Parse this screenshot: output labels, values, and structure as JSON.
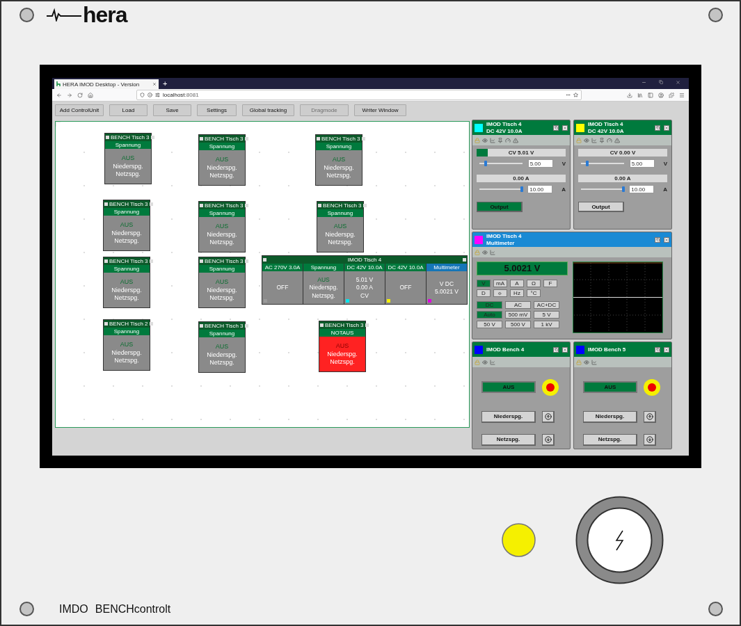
{
  "device": {
    "logo": "hera",
    "model": "IMDO",
    "product": "BENCHcontrolt"
  },
  "browser": {
    "tab_title": "HERA IMOD Desktop - Version",
    "new_tab": "+",
    "url_host": "localhost",
    "url_port": ":8081"
  },
  "toolbar": [
    {
      "label": "Add ControlUnit",
      "disabled": false
    },
    {
      "label": "Load",
      "disabled": false
    },
    {
      "label": "Save",
      "disabled": false
    },
    {
      "label": "Settings",
      "disabled": false
    },
    {
      "label": "Global tracking",
      "disabled": false
    },
    {
      "label": "Dragmode",
      "disabled": true
    },
    {
      "label": "Writer Window",
      "disabled": false
    }
  ],
  "canvas": {
    "cards": [
      {
        "title": "BENCH Tisch 3",
        "mode": "Spannung",
        "state": "AUS",
        "lines": [
          "Niederspg.",
          "Netzspg."
        ],
        "alarm": false
      },
      {
        "title": "BENCH Tisch 3",
        "mode": "Spannung",
        "state": "AUS",
        "lines": [
          "Niederspg.",
          "Netzspg."
        ],
        "alarm": false
      },
      {
        "title": "BENCH Tisch 3",
        "mode": "Spannung",
        "state": "AUS",
        "lines": [
          "Niederspg.",
          "Netzspg."
        ],
        "alarm": false
      },
      {
        "title": "BENCH Tisch 3",
        "mode": "Spannung",
        "state": "AUS",
        "lines": [
          "Niederspg.",
          "Netzspg."
        ],
        "alarm": false
      },
      {
        "title": "BENCH Tisch 3",
        "mode": "Spannung",
        "state": "AUS",
        "lines": [
          "Niederspg.",
          "Netzspg."
        ],
        "alarm": false
      },
      {
        "title": "BENCH Tisch 3",
        "mode": "Spannung",
        "state": "AUS",
        "lines": [
          "Niederspg.",
          "Netzspg."
        ],
        "alarm": false
      },
      {
        "title": "BENCH Tisch 3",
        "mode": "Spannung",
        "state": "AUS",
        "lines": [
          "Niederspg.",
          "Netzspg."
        ],
        "alarm": false
      },
      {
        "title": "BENCH Tisch 3",
        "mode": "Spannung",
        "state": "AUS",
        "lines": [
          "Niederspg.",
          "Netzspg."
        ],
        "alarm": false
      },
      {
        "title": "BENCH Tisch 2",
        "mode": "Spannung",
        "state": "AUS",
        "lines": [
          "Niederspg.",
          "Netzspg."
        ],
        "alarm": false
      },
      {
        "title": "BENCH Tisch 3",
        "mode": "Spannung",
        "state": "AUS",
        "lines": [
          "Niederspg.",
          "Netzspg."
        ],
        "alarm": false
      },
      {
        "title": "BENCH Tisch 3",
        "mode": "NOTAUS",
        "state": "AUS",
        "lines": [
          "Niederspg.",
          "Netzspg."
        ],
        "alarm": true
      }
    ],
    "module": {
      "title": "IMOD Tisch 4",
      "channels": [
        {
          "header": "AC 270V 3.0A",
          "selected": false,
          "color": "#9a9a9a",
          "lines": [
            {
              "text": "OFF",
              "kind": "plain"
            }
          ]
        },
        {
          "header": "Spannung",
          "selected": false,
          "lines": [
            {
              "text": "AUS",
              "kind": "status"
            },
            {
              "text": "Niederspg.",
              "kind": "plain"
            },
            {
              "text": "Netzspg.",
              "kind": "plain"
            }
          ]
        },
        {
          "header": "DC 42V 10.0A",
          "selected": false,
          "color": "#00e5ee",
          "lines": [
            {
              "text": "5.01 V",
              "kind": "plain"
            },
            {
              "text": "0.00 A",
              "kind": "plain"
            },
            {
              "text": "CV",
              "kind": "plain"
            }
          ]
        },
        {
          "header": "DC 42V 10.0A",
          "selected": false,
          "color": "#f5f000",
          "lines": [
            {
              "text": "OFF",
              "kind": "plain"
            }
          ]
        },
        {
          "header": "Multimeter",
          "selected": true,
          "color": "#e000e0",
          "lines": [
            {
              "text": "V DC",
              "kind": "plain"
            },
            {
              "text": "5.0021 V",
              "kind": "plain"
            }
          ]
        }
      ]
    }
  },
  "psus": [
    {
      "color": "#00ffff",
      "title": "IMOD Tisch 4",
      "subtitle": "DC 42V 10.0A",
      "cv_reading": "CV 5.01 V",
      "output_on": true,
      "output_label": "Output",
      "voltage": {
        "level": 0.15,
        "value": "5.00",
        "unit": "V"
      },
      "current": {
        "reading": "0.00 A",
        "level": 1.0,
        "value": "10.00",
        "unit": "A"
      }
    },
    {
      "color": "#ffff00",
      "title": "IMOD Tisch 4",
      "subtitle": "DC 42V 10.0A",
      "cv_reading": "CV 0.00 V",
      "output_on": false,
      "output_label": "Output",
      "voltage": {
        "level": 0.15,
        "value": "5.00",
        "unit": "V"
      },
      "current": {
        "reading": "0.00 A",
        "level": 1.0,
        "value": "10.00",
        "unit": "A"
      }
    }
  ],
  "multimeter": {
    "color": "#ff00ff",
    "title": "IMOD Tisch 4",
    "subtitle": "Multimeter",
    "reading": "5.0021 V",
    "groups": [
      [
        {
          "label": "V",
          "kind": "text",
          "selected": true
        },
        {
          "label": "mA",
          "kind": "text",
          "selected": false
        },
        {
          "label": "A",
          "kind": "text",
          "selected": false
        },
        {
          "label": "Ω",
          "kind": "text",
          "selected": false
        },
        {
          "label": "F",
          "kind": "text",
          "selected": false
        }
      ],
      [
        {
          "label": "D",
          "kind": "text",
          "selected": false
        },
        {
          "kind": "speaker",
          "selected": false
        },
        {
          "label": "Hz",
          "kind": "text",
          "selected": false
        },
        {
          "label": "°C",
          "kind": "text",
          "selected": false
        }
      ],
      [
        {
          "label": "DC",
          "kind": "text",
          "selected": true
        },
        {
          "label": "AC",
          "kind": "text",
          "selected": false
        },
        {
          "label": "AC+DC",
          "kind": "text",
          "selected": false
        }
      ],
      [
        {
          "label": "Auto",
          "kind": "text",
          "selected": true
        },
        {
          "label": "500 mV",
          "kind": "text",
          "selected": false
        },
        {
          "label": "5 V",
          "kind": "text",
          "selected": false
        }
      ],
      [
        {
          "label": "50 V",
          "kind": "text",
          "selected": false
        },
        {
          "label": "500 V",
          "kind": "text",
          "selected": false
        },
        {
          "label": "1 kV",
          "kind": "text",
          "selected": false
        }
      ]
    ]
  },
  "benches": [
    {
      "color": "#0000ff",
      "title": "IMOD Bench 4",
      "state": "AUS",
      "buttons": [
        "Niederspg.",
        "Netzspg."
      ]
    },
    {
      "color": "#0000ff",
      "title": "IMOD Bench 5",
      "state": "AUS",
      "buttons": [
        "Niederspg.",
        "Netzspg."
      ]
    }
  ]
}
